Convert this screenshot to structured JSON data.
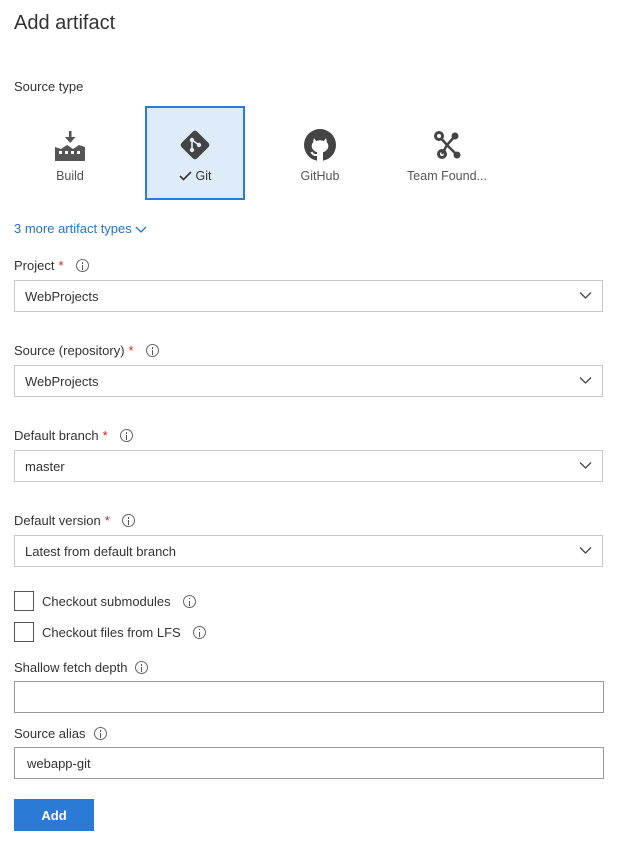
{
  "title": "Add artifact",
  "source_type_label": "Source type",
  "source_types": [
    {
      "label": "Build",
      "icon": "build-icon",
      "selected": false
    },
    {
      "label": "Git",
      "icon": "git-icon",
      "selected": true
    },
    {
      "label": "GitHub",
      "icon": "github-icon",
      "selected": false
    },
    {
      "label": "Team Found...",
      "icon": "team-foundation-icon",
      "selected": false
    }
  ],
  "more_types_link": "3 more artifact types",
  "fields": {
    "project": {
      "label": "Project",
      "value": "WebProjects"
    },
    "source": {
      "label": "Source (repository)",
      "value": "WebProjects"
    },
    "branch": {
      "label": "Default branch",
      "value": "master"
    },
    "version": {
      "label": "Default version",
      "value": "Latest from default branch"
    }
  },
  "checkboxes": {
    "submodules": {
      "label": "Checkout submodules",
      "checked": false
    },
    "lfs": {
      "label": "Checkout files from LFS",
      "checked": false
    }
  },
  "shallow_fetch": {
    "label": "Shallow fetch depth",
    "value": ""
  },
  "source_alias": {
    "label": "Source alias",
    "value": "webapp-git"
  },
  "required_marker": "*",
  "add_button": "Add",
  "colors": {
    "accent": "#2b7ad6",
    "link": "#1f74c9",
    "selected_bg": "#deecf9",
    "required": "#c4271d"
  }
}
